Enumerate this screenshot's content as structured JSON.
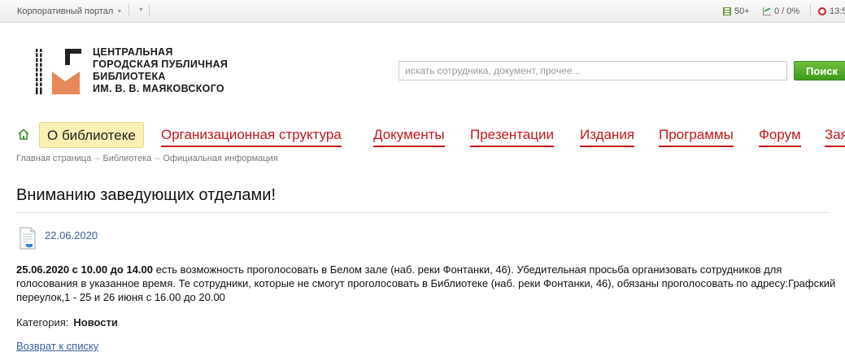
{
  "topbar": {
    "portal_label": "Корпоративный портал",
    "tasks_count": "50+",
    "efficiency": "0 / 0%",
    "time": "13:5"
  },
  "header": {
    "logo_line1": "ЦЕНТРАЛЬНАЯ",
    "logo_line2": "ГОРОДСКАЯ ПУБЛИЧНАЯ",
    "logo_line3": "БИБЛИОТЕКА",
    "logo_line4": "ИМ. В. В. МАЯКОВСКОГО",
    "search_placeholder": "искать сотрудника, документ, прочее...",
    "search_button": "Поиск"
  },
  "nav": {
    "active": "О библиотеке",
    "items": [
      "Организационная структура",
      "Документы",
      "Презентации",
      "Издания",
      "Программы",
      "Форум",
      "Зая"
    ]
  },
  "breadcrumb": [
    "Главная страница",
    "Библиотека",
    "Официальная информация"
  ],
  "article": {
    "title": "Вниманию заведующих отделами!",
    "date": "22.06.2020",
    "bold_lead": "25.06.2020 с 10.00 до 14.00",
    "text": " есть возможность проголосовать в Белом зале (наб. реки Фонтанки, 46). Убедительная просьба организовать сотрудников для голосования в указанное время. Те сотрудники, которые не смогут проголосовать в Библиотеке (наб. реки Фонтанки, 46), обязаны проголосовать по адресу:Графский переулок,1 - 25 и 26 июня с 16.00 до 20.00",
    "category_label": "Категория:",
    "category_value": "Новости",
    "back_link": "Возврат к списку"
  },
  "colors": {
    "nav_red": "#c4161c",
    "search_green": "#4aa323",
    "link_blue": "#3b5ea0",
    "active_tab": "#fbf0b4"
  }
}
